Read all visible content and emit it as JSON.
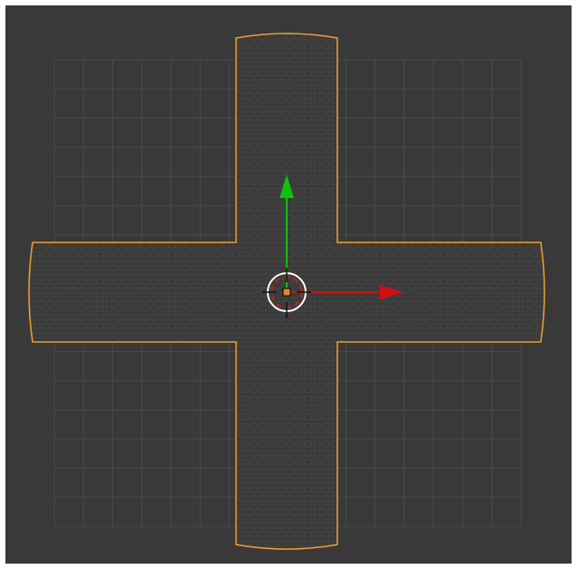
{
  "viewport": {
    "background_color": "#393939",
    "grid_color": "#4a4a4a",
    "grid": {
      "visible": true,
      "cells": 16
    }
  },
  "object": {
    "name_icon": "cross-mesh",
    "shape": "plus",
    "selected": true,
    "fill_color": "#3a3a3a",
    "texture_color": "#444444",
    "outline_color": "#f0a030"
  },
  "gizmo": {
    "x_axis_color": "#d01010",
    "y_axis_color": "#10c010",
    "origin_color": "#e08a30",
    "cursor_ring_color": "#ffffff",
    "cursor_dash_color": "#c02020"
  }
}
